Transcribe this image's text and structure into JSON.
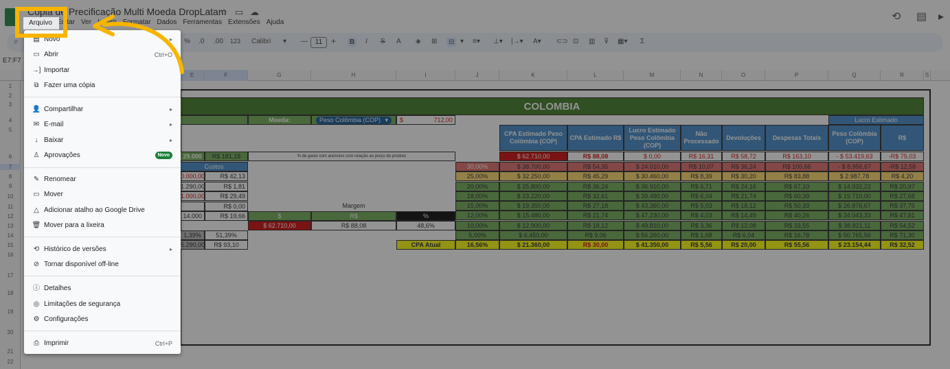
{
  "header": {
    "title": "Cópia de Precificação Multi Moeda DropLatam",
    "menu": [
      "Arquivo",
      "Editar",
      "Ver",
      "Inserir",
      "Formatar",
      "Dados",
      "Ferramentas",
      "Extensões",
      "Ajuda"
    ]
  },
  "toolbar": {
    "pct": "%",
    "dec_less": ".0",
    "dec_more": ".00",
    "num": "123",
    "font": "Calibri",
    "size": "11",
    "name_box": "E7:F7"
  },
  "columns": [
    "E",
    "F",
    "G",
    "H",
    "I",
    "J",
    "K",
    "L",
    "M",
    "N",
    "O",
    "P",
    "Q",
    "R",
    "S"
  ],
  "rows": [
    "1",
    "2",
    "3",
    "4",
    "5",
    "6",
    "7",
    "8",
    "9",
    "10",
    "11",
    "12",
    "13",
    "14",
    "15",
    "16",
    "17",
    "18",
    "19",
    "20",
    "21",
    "22"
  ],
  "sheet": {
    "title": "COLOMBIA",
    "moeda_label": "Moeda:",
    "moeda_value": "Peso Colômbia (COP)",
    "cur_sym": "$",
    "cur_value": "712,00",
    "lucro_header": "Lucro Estimado",
    "headers": [
      "CPA Estimado Peso Colômbia (COP)",
      "CPA Estimado R$",
      "Lucro Estimado Peso Colômbia (COP)",
      "Não Processado",
      "Devoluções",
      "Despesas Totais",
      "Peso Colômbia (COP)",
      "R$"
    ],
    "note": "% de gasto com anúncios com relação ao preço do produto",
    "left_vals": [
      "29.000",
      "R$ 181,18"
    ],
    "custos": "Custos",
    "custos_rows": [
      [
        "0.000,00",
        "R$ 42,13"
      ],
      [
        "1.290,00",
        "R$ 1,81"
      ],
      [
        "1.000,00",
        "R$ 29,49"
      ],
      [
        "",
        "R$ 0,00"
      ],
      [
        "14.000",
        "R$ 19,66"
      ]
    ],
    "bottom_left": [
      [
        "1,39%",
        "51,39%"
      ],
      [
        "5.290,00",
        "R$ 93,10"
      ]
    ],
    "margem": "Margem",
    "margem_hdr": [
      "$",
      "R$",
      "%"
    ],
    "margem_vals": [
      "$ 62.710,00",
      "R$ 88,08",
      "48,6%"
    ],
    "first_row": [
      "$ 62.710,00",
      "R$ 88,08",
      "$ 0,00",
      "R$ 16,31",
      "R$ 58,72",
      "R$ 163,10",
      "- $ 53.419,63",
      "-R$ 75,03"
    ],
    "data": [
      [
        "30,00%",
        "$ 38.700,00",
        "R$ 54,35",
        "$ 24.010,00",
        "R$ 10,07",
        "R$ 36,24",
        "R$ 100,66",
        "- $ 8.956,67",
        "-R$ 12,58"
      ],
      [
        "25,00%",
        "$ 32.250,00",
        "R$ 45,29",
        "$ 30.460,00",
        "R$ 8,39",
        "R$ 30,20",
        "R$ 83,88",
        "$ 2.987,78",
        "R$ 4,20"
      ],
      [
        "20,00%",
        "$ 25.800,00",
        "R$ 36,24",
        "$ 36.910,00",
        "R$ 6,71",
        "R$ 24,16",
        "R$ 67,10",
        "$ 14.932,22",
        "R$ 20,97"
      ],
      [
        "18,00%",
        "$ 23.220,00",
        "R$ 32,61",
        "$ 39.490,00",
        "R$ 6,04",
        "R$ 21,74",
        "R$ 60,39",
        "$ 19.710,00",
        "R$ 27,68"
      ],
      [
        "15,00%",
        "$ 19.350,00",
        "R$ 27,18",
        "$ 43.360,00",
        "R$ 5,03",
        "R$ 18,12",
        "R$ 50,33",
        "$ 26.876,67",
        "R$ 37,75"
      ],
      [
        "12,00%",
        "$ 15.480,00",
        "R$ 21,74",
        "$ 47.230,00",
        "R$ 4,03",
        "R$ 14,49",
        "R$ 40,26",
        "$ 34.043,33",
        "R$ 47,81"
      ],
      [
        "10,00%",
        "$ 12.900,00",
        "R$ 18,12",
        "$ 49.810,00",
        "R$ 3,36",
        "R$ 12,08",
        "R$ 33,55",
        "$ 38.821,11",
        "R$ 54,52"
      ],
      [
        "5,00%",
        "$ 6.450,00",
        "R$ 9,06",
        "$ 56.260,00",
        "R$ 1,68",
        "R$ 6,04",
        "R$ 16,78",
        "$ 50.765,56",
        "R$ 71,30"
      ],
      [
        "16,56%",
        "$ 21.360,00",
        "R$ 30,00",
        "$ 41.350,00",
        "R$ 5,56",
        "R$ 20,00",
        "R$ 55,56",
        "$ 23.154,44",
        "R$ 32,52"
      ]
    ],
    "cpa_atual": "CPA Atual"
  },
  "menu": {
    "novo": "Novo",
    "abrir": "Abrir",
    "abrir_sc": "Ctrl+O",
    "importar": "Importar",
    "copia": "Fazer uma cópia",
    "compartilhar": "Compartilhar",
    "email": "E-mail",
    "baixar": "Baixar",
    "aprovacoes": "Aprovações",
    "novo_badge": "Novo",
    "renomear": "Renomear",
    "mover": "Mover",
    "atalho": "Adicionar atalho ao Google Drive",
    "lixeira": "Mover para a lixeira",
    "historico": "Histórico de versões",
    "offline": "Tornar disponível off-line",
    "detalhes": "Detalhes",
    "limitacoes": "Limitações de segurança",
    "config": "Configurações",
    "imprimir": "Imprimir",
    "imprimir_sc": "Ctrl+P"
  },
  "colors": {
    "green": "#6aa84f",
    "red": "#e06666",
    "yellow": "#ffd966",
    "dark_red": "#cc0000",
    "title_bg": "#38761d",
    "header_blue": "#3d85c6"
  }
}
